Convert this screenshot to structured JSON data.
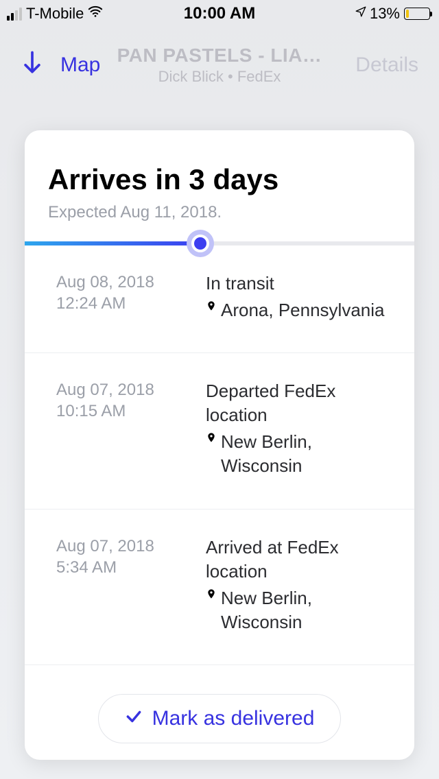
{
  "statusBar": {
    "carrier": "T-Mobile",
    "time": "10:00 AM",
    "battery": "13%"
  },
  "nav": {
    "map": "Map",
    "title": "PAN PASTELS - LIA…",
    "subtitle": "Dick Blick • FedEx",
    "details": "Details"
  },
  "header": {
    "arrives": "Arrives in 3 days",
    "expected": "Expected Aug 11, 2018."
  },
  "events": [
    {
      "date": "Aug 08, 2018",
      "time": "12:24 AM",
      "status": "In transit",
      "location": "Arona, Pennsylvania"
    },
    {
      "date": "Aug 07, 2018",
      "time": "10:15 AM",
      "status": "Departed FedEx location",
      "location": "New Berlin, Wisconsin"
    },
    {
      "date": "Aug 07, 2018",
      "time": "5:34 AM",
      "status": "Arrived at FedEx location",
      "location": "New Berlin, Wisconsin"
    }
  ],
  "markDelivered": "Mark as delivered"
}
